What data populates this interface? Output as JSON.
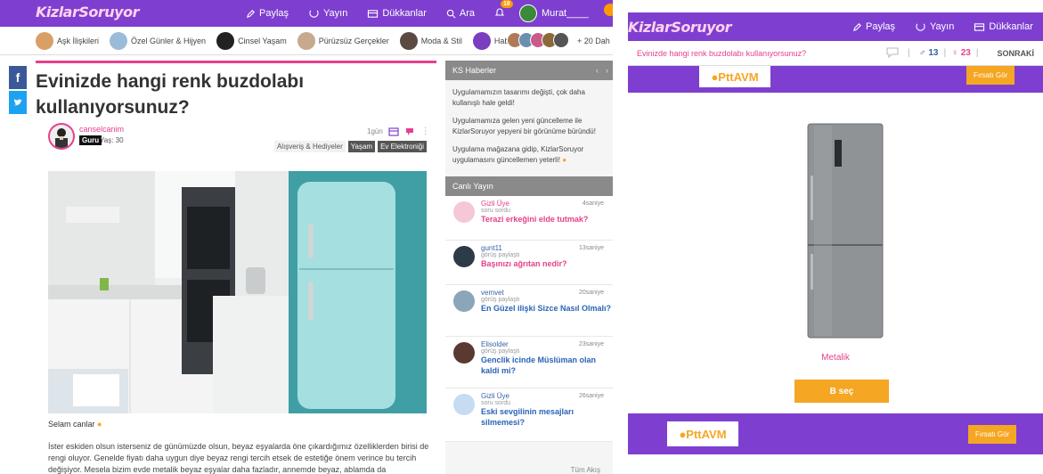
{
  "left": {
    "logo": "KizlarSoruyor",
    "nav": {
      "share": "Paylaş",
      "live": "Yayın",
      "shops": "Dükkanlar",
      "search": "Ara",
      "notifications": "18",
      "user": "Murat____"
    },
    "categories": [
      "Aşk İlişkileri",
      "Özel Günler & Hijyen",
      "Cinsel Yaşam",
      "Pürüzsüz Gerçekler",
      "Moda & Stil",
      "Haberler"
    ],
    "categories_more": "+ 20 Dah",
    "article": {
      "title": "Evinizde hangi renk buzdolabı kullanıyorsunuz?",
      "author": "canselcanim",
      "badge": "Guru",
      "age": "Yaş: 30",
      "time": "1gün",
      "tags": [
        "Alışveriş & Hediyeler",
        "Yaşam",
        "Ev Elektroniği"
      ],
      "greeting": "Selam canlar",
      "body": "İster eskiden olsun isterseniz de günümüzde olsun, beyaz eşyalarda öne çıkardığımız özelliklerden birisi de rengi oluyor. Genelde fiyatı daha uygun diye beyaz rengi tercih etsek de estetiğe önem verince bu tercih değişiyor. Mesela bizim evde metalik beyaz eşyalar daha fazladır, annemde beyaz, ablamda da"
    },
    "news": {
      "header": "KS Haberler",
      "items": [
        "Uygulamamızın tasarımı değişti, çok daha kullanışlı hale geldi!",
        "Uygulamamıza gelen yeni güncelleme ile KizlarSoruyor yepyeni bir görünüme büründü!",
        "Uygulama mağazana gidip, KizlarSoruyor uygulamasını güncellemen yeterli!"
      ]
    },
    "live": {
      "header": "Canlı Yayın",
      "items": [
        {
          "user": "Gizli Üye",
          "action": "soru sordu",
          "question": "Terazi erkeğini elde tutmak?",
          "time": "4saniye"
        },
        {
          "user": "gunt11",
          "action": "görüş paylaştı",
          "question": "Başınızı ağrıtan nedir?",
          "time": "13saniye"
        },
        {
          "user": "vemvet",
          "action": "görüş paylaştı",
          "question": "En Güzel ilişki Sizce Nasıl Olmalı?",
          "time": "20saniye"
        },
        {
          "user": "Elisolder",
          "action": "görüş paylaştı",
          "question": "Genclik icinde Müslüman olan kaldi mi?",
          "time": "23saniye"
        },
        {
          "user": "Gizli Üye",
          "action": "soru sordu",
          "question": "Eski sevgilinin mesajları silmemesi?",
          "time": "26saniye"
        }
      ],
      "all": "Tüm Akış"
    }
  },
  "right": {
    "logo": "KizlarSoruyor",
    "nav": {
      "share": "Paylaş",
      "live": "Yayın",
      "shops": "Dükkanlar"
    },
    "question": "Evinizde hangi renk buzdolabı kullanıyorsunuz?",
    "male_count": "13",
    "female_count": "23",
    "next": "SONRAKİ",
    "store": "PttAVM",
    "deal": "Fırsatı Gör",
    "option_label": "Metalik",
    "choose": "B seç"
  },
  "colors": {
    "brand_purple": "#7e3fd0",
    "accent_pink": "#e5408d",
    "accent_orange": "#f5a623",
    "link_blue": "#2a64b5"
  }
}
